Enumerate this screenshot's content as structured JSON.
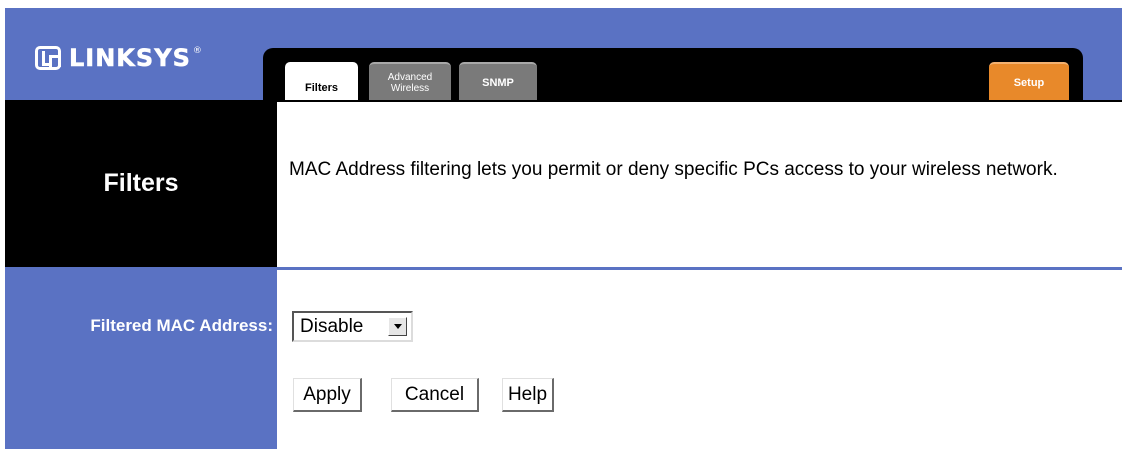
{
  "header": {
    "logo_text": "LINKSYS",
    "logo_registered": "®",
    "tabs": [
      {
        "label": "Filters"
      },
      {
        "label_line1": "Advanced",
        "label_line2": "Wireless"
      },
      {
        "label": "SNMP"
      }
    ],
    "setup_tab": "Setup"
  },
  "section": {
    "title": "Filters",
    "description": "MAC Address filtering lets you permit or deny specific PCs access to your wireless network."
  },
  "settings": {
    "mac_label": "Filtered MAC Address:",
    "mac_select_value": "Disable"
  },
  "buttons": {
    "apply": "Apply",
    "cancel": "Cancel",
    "help": "Help"
  },
  "colors": {
    "brand_blue": "#5a72c3",
    "black": "#000000",
    "setup_orange": "#e8892a",
    "inactive_tab": "#7a7a7a"
  }
}
